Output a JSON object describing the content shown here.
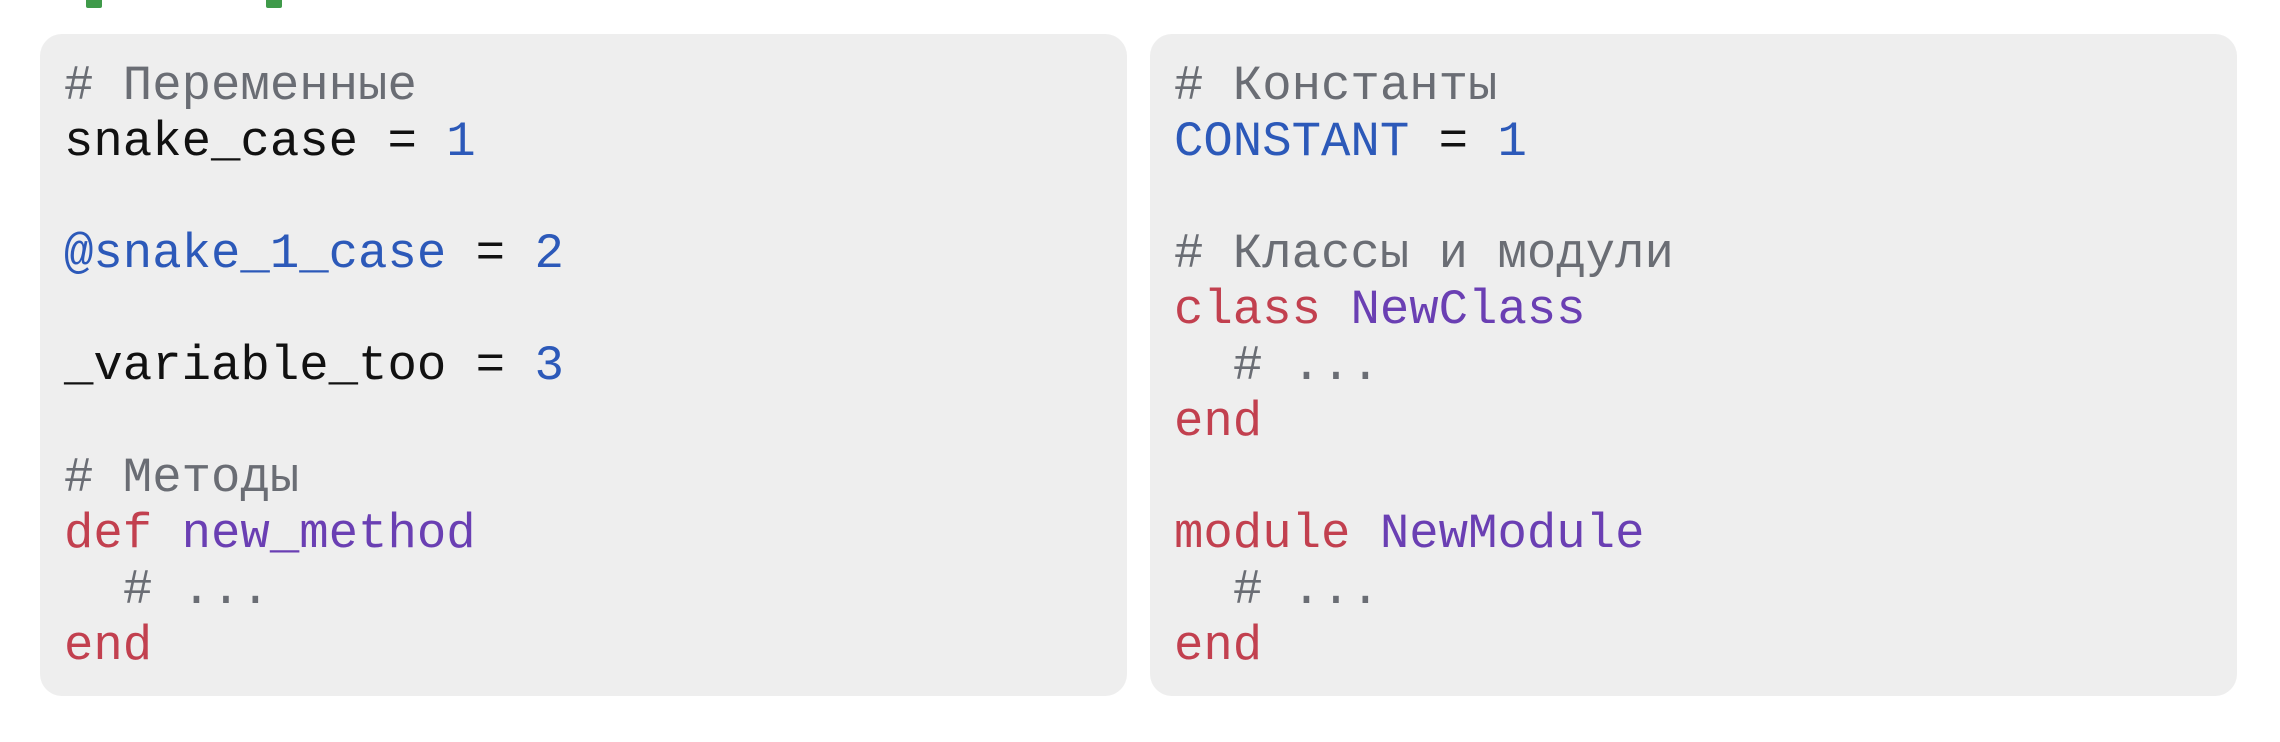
{
  "colors": {
    "accent_green": "#3f9a4a",
    "panel_bg": "#eeeeee",
    "comment": "#6a6d74",
    "number": "#2c59b9",
    "keyword": "#c2404f",
    "name": "#6a3fb3"
  },
  "left": {
    "comment_variables": "# Переменные",
    "snake_case_name": "snake_case",
    "assign_1": " = ",
    "value_1": "1",
    "ivar_name": "@snake_1_case",
    "assign_2": " = ",
    "value_2": "2",
    "underscore_name": "_variable_too",
    "assign_3": " = ",
    "value_3": "3",
    "comment_methods": "# Методы",
    "def_keyword": "def",
    "method_name": "new_method",
    "method_body": "# ...",
    "end_keyword": "end"
  },
  "right": {
    "comment_constants": "# Константы",
    "constant_name": "CONSTANT",
    "assign": " = ",
    "constant_value": "1",
    "comment_classes": "# Классы и модули",
    "class_keyword": "class",
    "class_name": "NewClass",
    "class_body": "# ...",
    "class_end": "end",
    "module_keyword": "module",
    "module_name": "NewModule",
    "module_body": "# ...",
    "module_end": "end"
  }
}
